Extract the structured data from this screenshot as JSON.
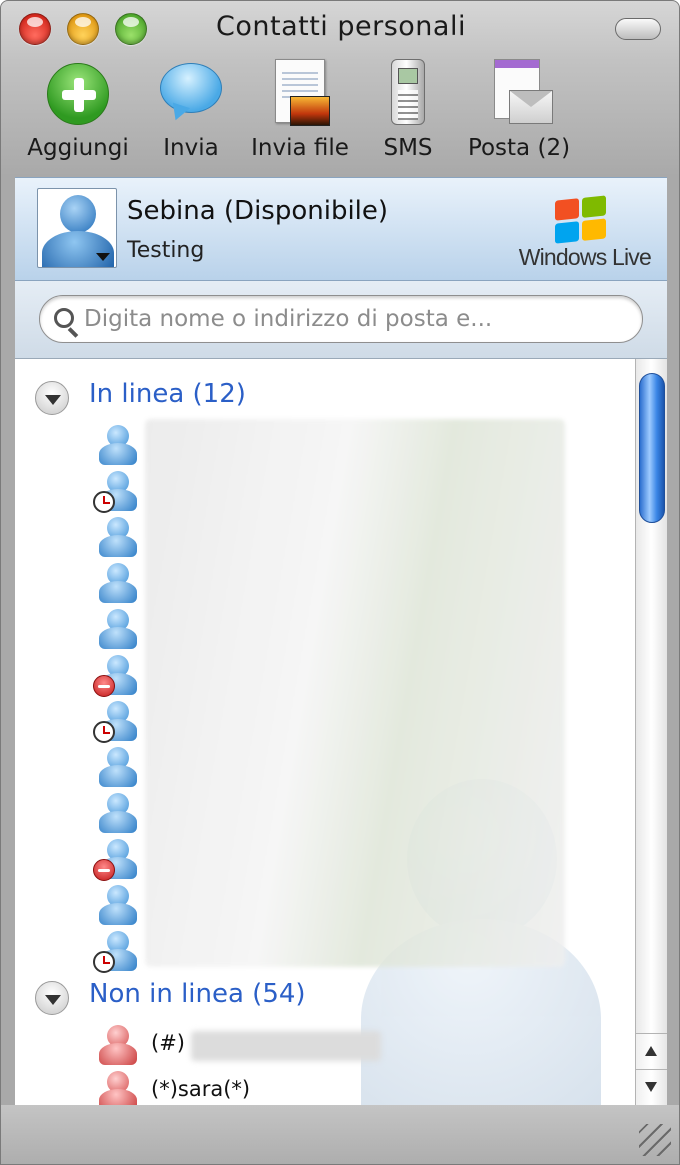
{
  "window": {
    "title": "Contatti personali"
  },
  "toolbar": {
    "add_label": "Aggiungi",
    "send_label": "Invia",
    "send_file_label": "Invia file",
    "sms_label": "SMS",
    "mail_label": "Posta (2)"
  },
  "profile": {
    "name": "Sebina (Disponibile)",
    "status_message": "Testing",
    "brand": "Windows Live"
  },
  "search": {
    "placeholder": "Digita nome o indirizzo di posta e..."
  },
  "groups": {
    "online": {
      "label": "In linea (12)"
    },
    "offline": {
      "label": "Non in linea (54)"
    }
  },
  "offline_contacts": [
    {
      "name": "(#)"
    },
    {
      "name": "(*)sara(*)"
    }
  ],
  "icons": {
    "add": "add-contact-icon",
    "send": "speech-bubble-icon",
    "send_file": "file-picture-icon",
    "sms": "mobile-phone-icon",
    "mail": "mail-envelope-icon",
    "search": "search-icon",
    "disclosure": "disclosure-triangle-icon"
  },
  "colors": {
    "group_label": "#2b5fc7",
    "online_contact": "#3b8fd6",
    "offline_contact": "#d65252",
    "scroll_thumb": "#3a86e6"
  }
}
